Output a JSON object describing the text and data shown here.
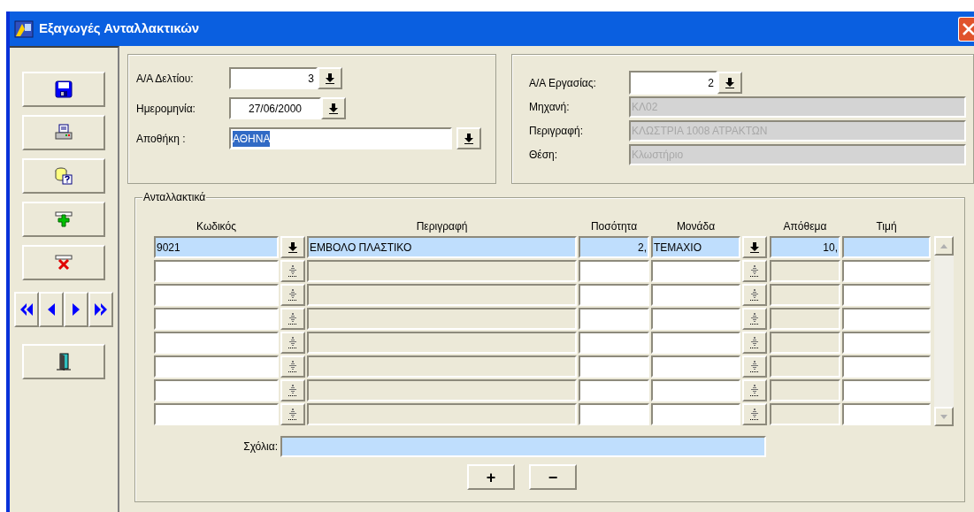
{
  "window": {
    "title": "Εξαγωγές Ανταλλακτικών"
  },
  "toolbar": [
    {
      "kind": "save"
    },
    {
      "kind": "print"
    },
    {
      "kind": "query"
    },
    {
      "kind": "add"
    },
    {
      "kind": "delete"
    }
  ],
  "navigation": [
    {
      "kind": "first"
    },
    {
      "kind": "previous"
    },
    {
      "kind": "next"
    },
    {
      "kind": "last"
    }
  ],
  "document": {
    "fields": [
      {
        "label": "Α/Α Δελτίου:",
        "value": "3",
        "kind": "number",
        "highlighted": false
      },
      {
        "label": "Ημερομηνία:",
        "value": "27/06/2000",
        "kind": "date",
        "highlighted": false
      },
      {
        "label": "Αποθήκη :",
        "value": "ΑΘΗΝΑ",
        "kind": "text",
        "highlighted": true
      }
    ]
  },
  "job": {
    "fields": [
      {
        "label": "Α/Α Εργασίας:",
        "value": "2",
        "kind": "lookup"
      },
      {
        "label": "Μηχανή:",
        "value": "ΚΛ02",
        "kind": "readonly"
      },
      {
        "label": "Περιγραφή:",
        "value": "ΚΛΩΣΤΡΙΑ 1008 ΑΤΡΑΚΤΩΝ",
        "kind": "readonly"
      },
      {
        "label": "Θέση:",
        "value": "Κλωστήριο",
        "kind": "readonly"
      }
    ]
  },
  "parts": {
    "title": "Ανταλλακτικά",
    "columns": [
      "Κωδικός",
      "Περιγραφή",
      "Ποσότητα",
      "Μονάδα",
      "Απόθεμα",
      "Τιμή"
    ],
    "rows": [
      {
        "selected": true,
        "code": "9021",
        "description": "ΕΜΒΟΛΟ ΠΛΑΣΤΙΚΟ",
        "quantity": "2,",
        "unit": "ΤΕΜΑΧΙΟ",
        "stock": "10,"
      },
      {
        "selected": false
      },
      {
        "selected": false
      },
      {
        "selected": false
      },
      {
        "selected": false
      },
      {
        "selected": false
      },
      {
        "selected": false
      },
      {
        "selected": false
      }
    ]
  },
  "comments": {
    "label": "Σχόλια:"
  },
  "buttons": [
    "+",
    "−"
  ]
}
